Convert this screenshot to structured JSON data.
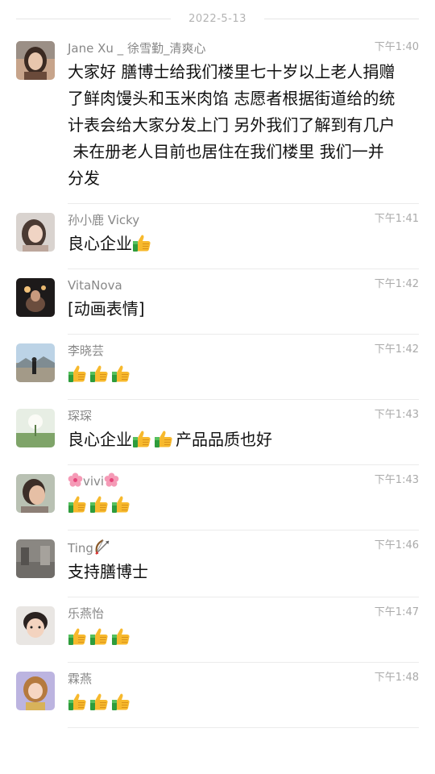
{
  "date_divider": "2022-5-13",
  "messages": [
    {
      "sender": "Jane Xu _ 徐雪勤_清爽心",
      "time": "下午1:40",
      "lines": [
        "大家好 膳博士给我们楼里七十岁以上老人捐赠",
        "了鲜肉馒头和玉米肉馅 志愿者根据街道给的统",
        "计表会给大家分发上门 另外我们了解到有几户",
        " 未在册老人目前也居住在我们楼里 我们一并",
        "分发"
      ]
    },
    {
      "sender": "孙小鹿 Vicky",
      "time": "下午1:41",
      "text": "良心企业"
    },
    {
      "sender": "VitaNova",
      "time": "下午1:42",
      "text": "[动画表情]"
    },
    {
      "sender": "李晓芸",
      "time": "下午1:42"
    },
    {
      "sender": "琛琛",
      "time": "下午1:43",
      "text_a": "良心企业",
      "text_b": "产品品质也好"
    },
    {
      "sender": "vivi",
      "time": "下午1:43"
    },
    {
      "sender": "Ting",
      "time": "下午1:46",
      "text": "支持膳博士"
    },
    {
      "sender": "乐燕怡",
      "time": "下午1:47"
    },
    {
      "sender": "霖燕",
      "time": "下午1:48"
    }
  ],
  "icons": {
    "thumb": "thumbs-up-emoji",
    "flower": "cherry-blossom-emoji",
    "bow": "bow-and-arrow-emoji"
  },
  "colors": {
    "sender": "#888888",
    "time": "#aaaaaa",
    "divider": "#ebebeb",
    "text": "#111111"
  }
}
